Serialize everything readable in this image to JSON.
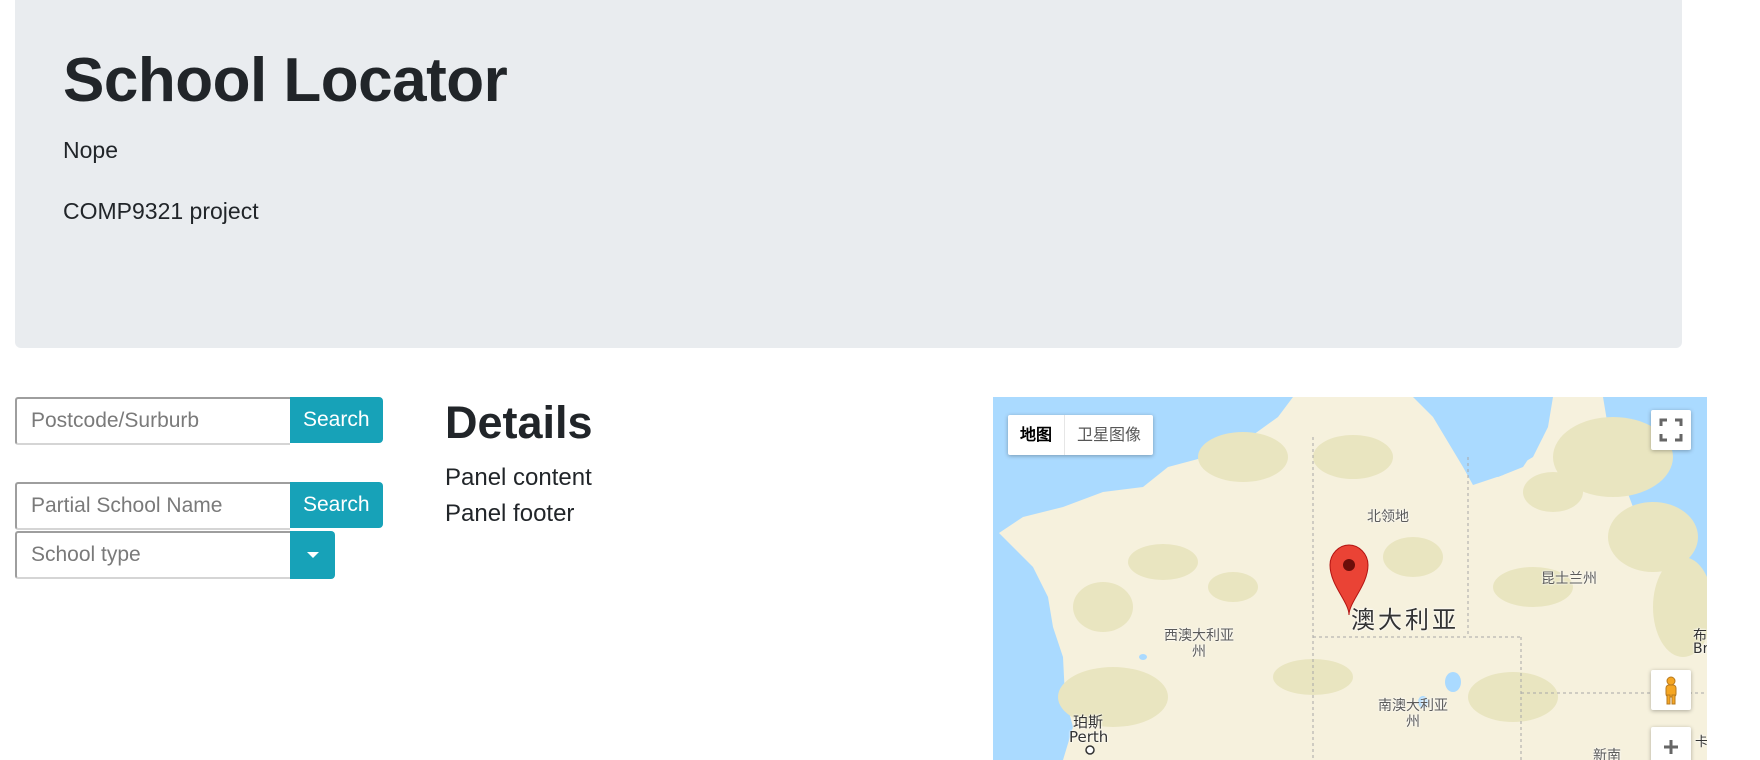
{
  "header": {
    "title": "School Locator",
    "subtitle": "Nope",
    "tagline": "COMP9321 project"
  },
  "search": {
    "postcode_placeholder": "Postcode/Surburb",
    "postcode_value": "",
    "postcode_button": "Search",
    "school_name_placeholder": "Partial School Name",
    "school_name_value": "",
    "school_name_button": "Search",
    "school_type_placeholder": "School type",
    "school_type_value": ""
  },
  "details": {
    "heading": "Details",
    "content": "Panel content",
    "footer": "Panel footer"
  },
  "map": {
    "type_buttons": [
      "地图",
      "卫星图像"
    ],
    "active_type": "地图",
    "labels": {
      "northern_territory": "北领地",
      "queensland": "昆士兰州",
      "australia": "澳大利亚",
      "western_australia": "西澳大利亚州",
      "south_australia": "南澳大利亚州",
      "perth_cn": "珀斯",
      "perth_en": "Perth",
      "nsw_partial": "新南",
      "brisbane_cn_partial": "布",
      "brisbane_en_partial": "Br",
      "canberra_partial": "卡"
    },
    "icons": {
      "fullscreen": "fullscreen-icon",
      "pegman": "pegman-icon",
      "zoom_in": "zoom-in-icon",
      "marker": "map-marker-icon"
    },
    "colors": {
      "water": "#aadaff",
      "land": "#f6f1dd",
      "vegetation": "#e9e5c0",
      "marker": "#ea4335",
      "accent_button": "#17a2b8"
    }
  }
}
